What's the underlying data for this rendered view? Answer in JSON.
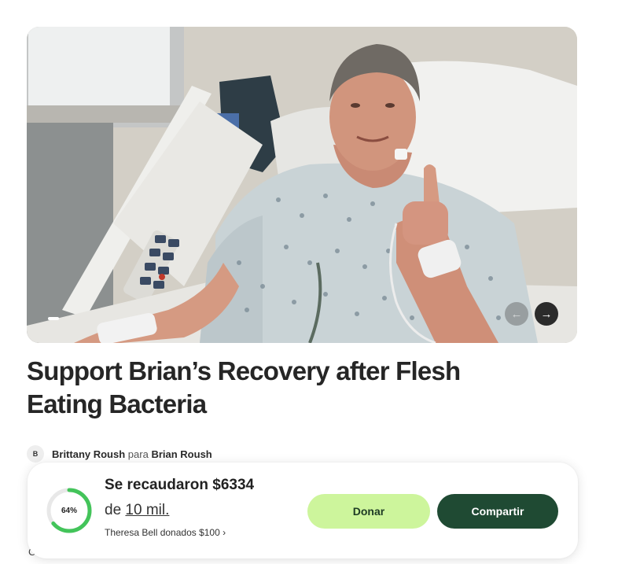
{
  "campaign": {
    "title": "Support Brian’s Recovery after Flesh Eating Bacteria",
    "organizer_initial": "B",
    "organizer_name": "Brittany Roush",
    "connector": "para",
    "beneficiary_name": "Brian Roush"
  },
  "carousel": {
    "prev_icon": "←",
    "next_icon": "→"
  },
  "donation": {
    "raised_text": "Se recaudaron $6334",
    "goal_prefix": "de",
    "goal_amount": "10 mil.",
    "progress_percent": 64,
    "progress_label": "64%",
    "recent_donation": "Theresa Bell donados $100 ›",
    "donate_label": "Donar",
    "share_label": "Compartir"
  },
  "truncated_text": "C.",
  "colors": {
    "progress": "#43c45a",
    "donate_bg": "#cdf59c",
    "share_bg": "#1f4a33"
  }
}
